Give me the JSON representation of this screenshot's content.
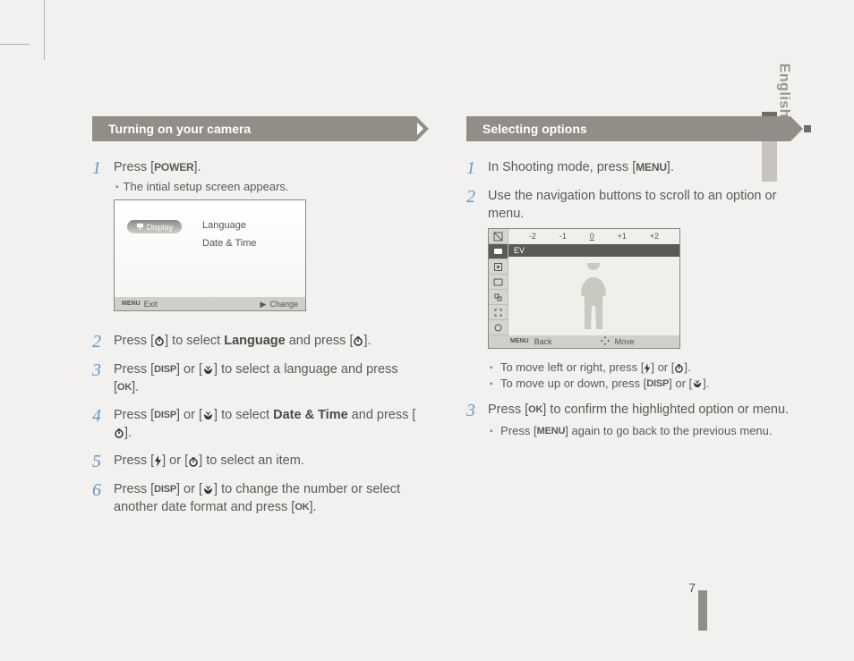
{
  "page_number": "7",
  "language_tab": "English",
  "left": {
    "heading": "Turning on your camera",
    "steps": {
      "s1": {
        "pre": "Press [",
        "btn": "POWER",
        "post": "].",
        "sub": "The intial setup screen appears."
      },
      "screenshot1": {
        "pill": "Display",
        "label1": "Language",
        "label2": "Date & Time",
        "foot_left_icon": "MENU",
        "foot_left": "Exit",
        "foot_right": "Change"
      },
      "s2": {
        "t1": "Press [",
        "t2": "] to select ",
        "bold": "Language",
        "t3": " and press [",
        "t4": "]."
      },
      "s3": {
        "t1": "Press [",
        "t2": "] or [",
        "t3": "] to select a language and press [",
        "t4": "]."
      },
      "s4": {
        "t1": "Press [",
        "t2": "] or [",
        "t3": "] to select ",
        "bold": "Date & Time",
        "t4": " and press [",
        "t5": "]."
      },
      "s5": {
        "t1": "Press [",
        "t2": "] or [",
        "t3": "] to select an item."
      },
      "s6": {
        "t1": "Press [",
        "t2": "] or [",
        "t3": "] to change the number or select another date format and press [",
        "t4": "]."
      },
      "btn": {
        "disp": "DISP",
        "macro": "",
        "ok": "OK",
        "menu": "MENU"
      }
    }
  },
  "right": {
    "heading": "Selecting options",
    "steps": {
      "s1": {
        "t1": "In Shooting mode, press [",
        "btn": "MENU",
        "t2": "]."
      },
      "s2": {
        "t": "Use the navigation buttons to scroll to an option or menu."
      },
      "screenshot2": {
        "ticks": [
          "-2",
          "-1",
          "0",
          "+1",
          "+2"
        ],
        "row": "EV",
        "foot_back": "Back",
        "foot_move": "Move"
      },
      "sub1": {
        "t1": "To move left or right, press [",
        "t2": "] or [",
        "t3": "]."
      },
      "sub2": {
        "t1": "To move up or down, press [",
        "t2": "] or [",
        "t3": "]."
      },
      "s3": {
        "t1": "Press [",
        "btn": "OK",
        "t2": "] to confirm the highlighted option or menu.",
        "sub_t1": "Press [",
        "sub_btn": "MENU",
        "sub_t2": "] again to go back to the previous menu."
      }
    }
  }
}
